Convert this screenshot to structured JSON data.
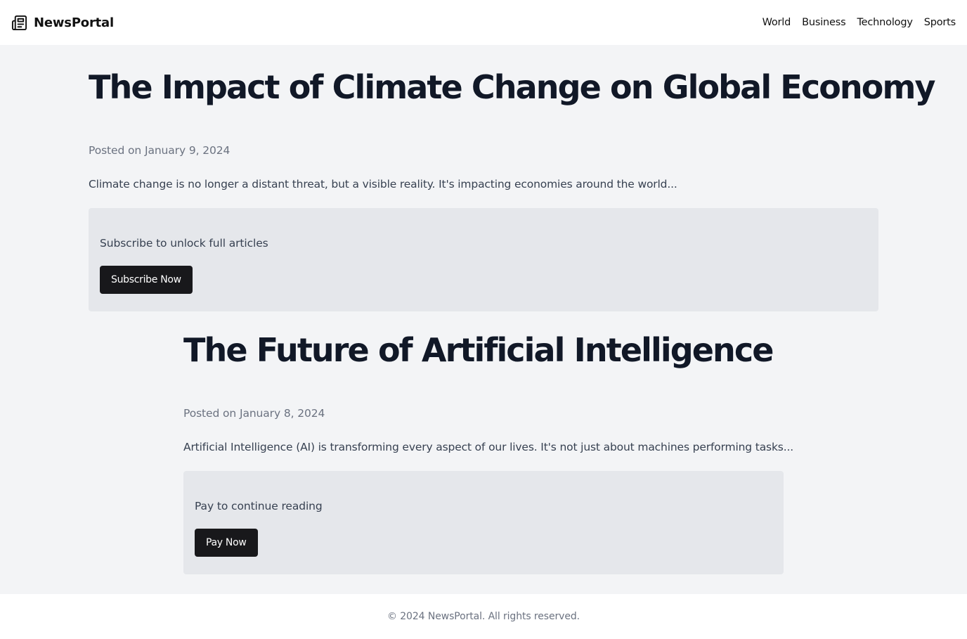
{
  "header": {
    "brand_name": "NewsPortal",
    "logo_icon": "newspaper-icon",
    "nav": [
      {
        "label": "World"
      },
      {
        "label": "Business"
      },
      {
        "label": "Technology"
      },
      {
        "label": "Sports"
      }
    ]
  },
  "articles": [
    {
      "title": "The Impact of Climate Change on Global Economy",
      "posted": "Posted on January 9, 2024",
      "excerpt": "Climate change is no longer a distant threat, but a visible reality. It's impacting economies around the world...",
      "paywall_text": "Subscribe to unlock full articles",
      "button_label": "Subscribe Now"
    },
    {
      "title": "The Future of Artificial Intelligence",
      "posted": "Posted on January 8, 2024",
      "excerpt": "Artificial Intelligence (AI) is transforming every aspect of our lives. It's not just about machines performing tasks...",
      "paywall_text": "Pay to continue reading",
      "button_label": "Pay Now"
    }
  ],
  "footer": {
    "text": "© 2024 NewsPortal. All rights reserved."
  },
  "colors": {
    "header_bg": "#ffffff",
    "page_bg": "#f3f4f6",
    "title": "#111827",
    "meta": "#6b7280",
    "body_text": "#374151",
    "paywall_bg": "#e5e7eb",
    "button_bg": "#18181b",
    "button_text": "#ffffff"
  }
}
